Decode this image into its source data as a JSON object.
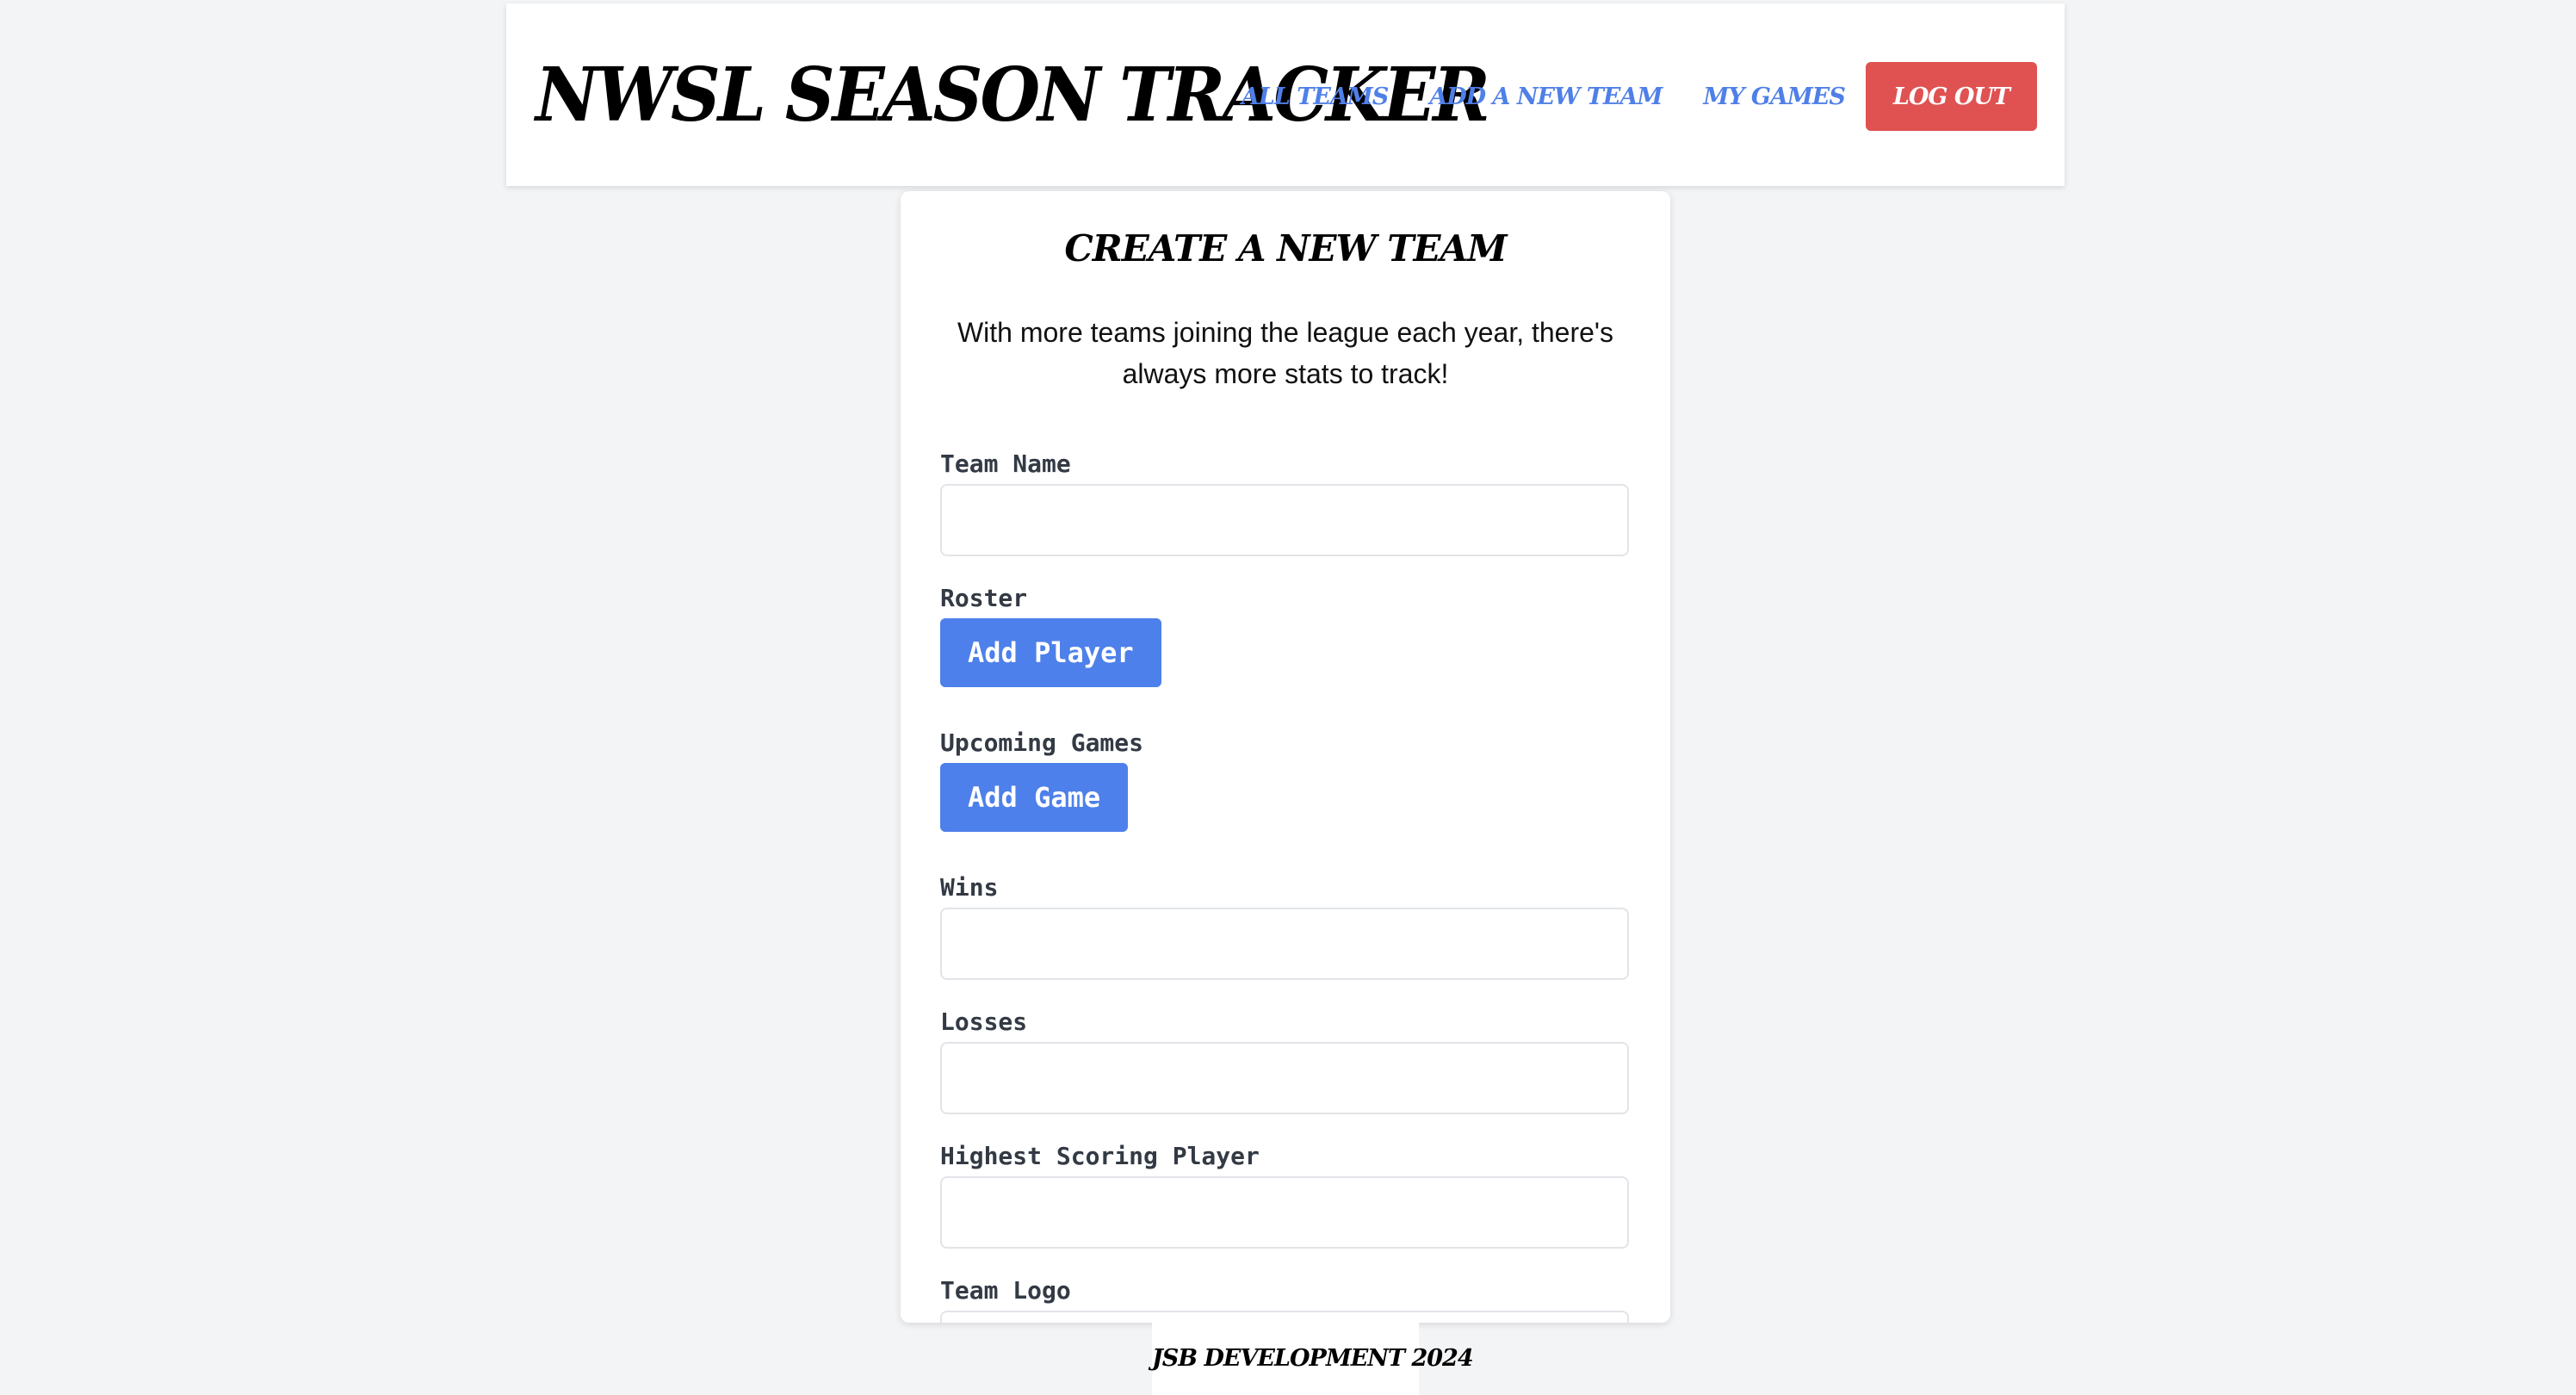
{
  "header": {
    "brand": "NWSL SEASON TRACKER",
    "nav": {
      "all_teams": "ALL TEAMS",
      "add_team": "ADD A NEW TEAM",
      "my_games": "MY GAMES",
      "logout": "LOG OUT"
    }
  },
  "form": {
    "title": "CREATE A NEW TEAM",
    "intro": "With more teams joining the league each year, there's always more stats to track!",
    "team_name_label": "Team Name",
    "roster_label": "Roster",
    "add_player_button": "Add Player",
    "upcoming_games_label": "Upcoming Games",
    "add_game_button": "Add Game",
    "wins_label": "Wins",
    "losses_label": "Losses",
    "highest_scorer_label": "Highest Scoring Player",
    "team_logo_label": "Team Logo"
  },
  "footer": {
    "text": "JSB DEVELOPMENT 2024"
  },
  "colors": {
    "accent": "#4d80ea",
    "danger": "#e05252",
    "background": "#f3f4f6"
  }
}
